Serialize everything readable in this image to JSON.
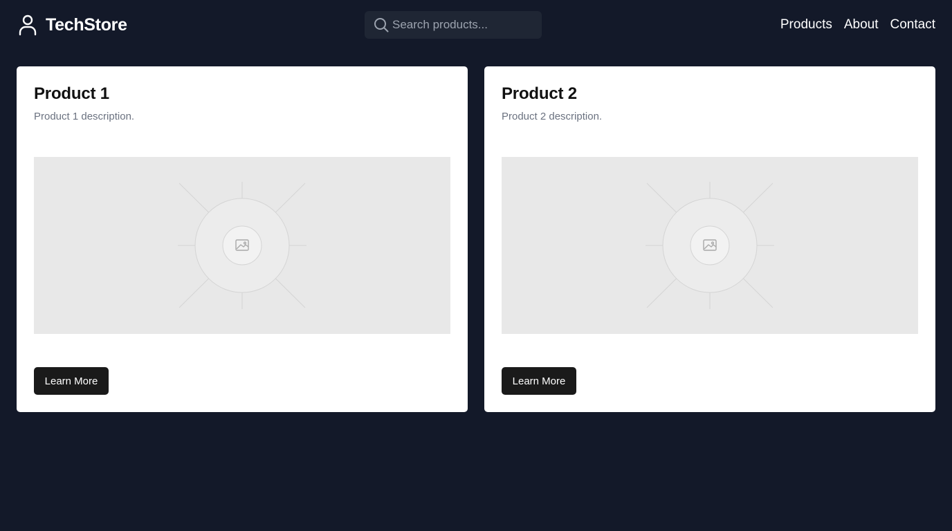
{
  "brand": {
    "name": "TechStore",
    "icon": "user-icon"
  },
  "search": {
    "placeholder": "Search products...",
    "value": ""
  },
  "nav": {
    "items": [
      "Products",
      "About",
      "Contact"
    ]
  },
  "products": [
    {
      "title": "Product 1",
      "description": "Product 1 description.",
      "button_label": "Learn More",
      "image_icon": "image-placeholder-icon"
    },
    {
      "title": "Product 2",
      "description": "Product 2 description.",
      "button_label": "Learn More",
      "image_icon": "image-placeholder-icon"
    }
  ],
  "colors": {
    "background": "#131929",
    "search_bg": "#1f2634",
    "card_bg": "#ffffff",
    "button_bg": "#1a1a1a",
    "image_bg": "#e8e8e8"
  }
}
